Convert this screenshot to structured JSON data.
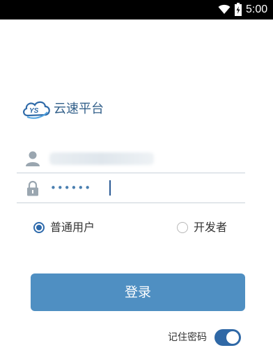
{
  "status_bar": {
    "time": "5:00",
    "wifi_icon": "wifi-icon",
    "battery_icon": "battery-charging-icon"
  },
  "brand": {
    "logo_icon": "ys-cloud-logo-icon",
    "name": "云速平台",
    "color": "#33608a"
  },
  "form": {
    "username": {
      "icon": "user-icon",
      "value": ""
    },
    "password": {
      "icon": "lock-icon",
      "value": "••••••"
    },
    "user_types": [
      {
        "label": "普通用户",
        "selected": true
      },
      {
        "label": "开发者",
        "selected": false
      }
    ],
    "login_label": "登录",
    "remember": {
      "label": "记住密码",
      "on": true
    }
  },
  "colors": {
    "accent": "#4f8fc2",
    "toggle": "#2f68a6",
    "radio": "#2e6aab"
  }
}
